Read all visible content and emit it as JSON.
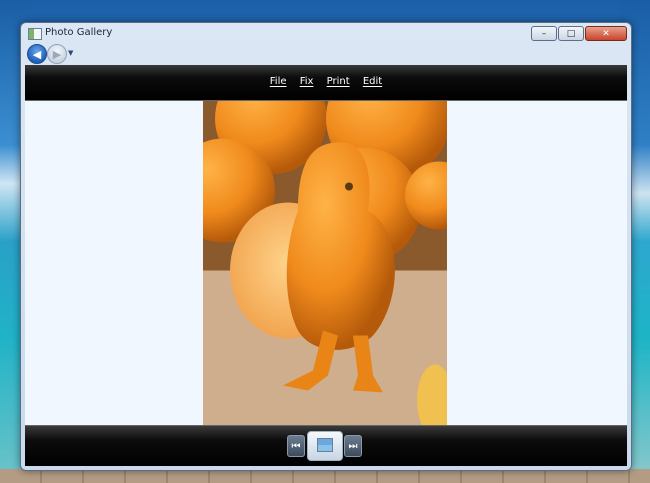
{
  "window": {
    "title": "Photo Gallery",
    "caption_buttons": {
      "minimize": "–",
      "maximize": "□",
      "close": "✕"
    }
  },
  "navigation": {
    "back_icon": "◀",
    "forward_icon": "▶",
    "history_dropdown_icon": "▼"
  },
  "menu": {
    "items": [
      "File",
      "Fix",
      "Print",
      "Edit"
    ]
  },
  "playback": {
    "previous_icon": "⏮",
    "next_icon": "⏭"
  },
  "colors": {
    "toolbar_bg": "#000000",
    "stage_bg": "#f0f7ff",
    "close_button": "#c9452a"
  }
}
